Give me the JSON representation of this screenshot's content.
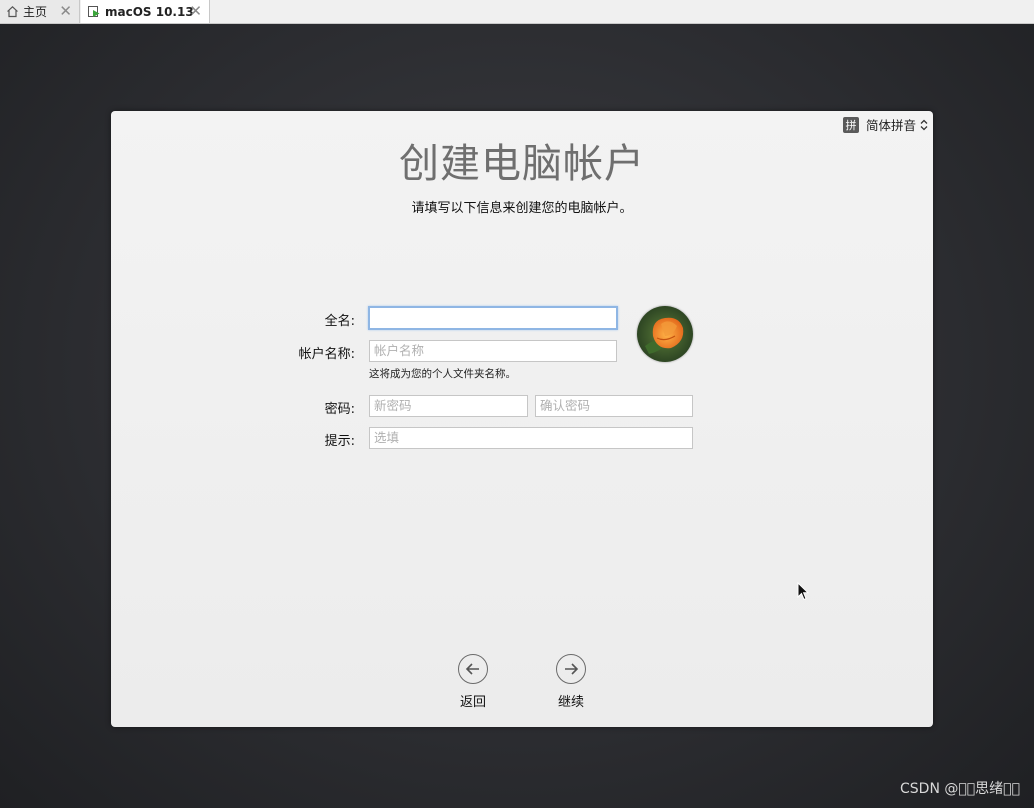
{
  "tabs": [
    {
      "label": "主页",
      "icon": "home-icon",
      "close": "✕"
    },
    {
      "label": "macOS 10.13",
      "icon": "vm-icon",
      "close": "✕"
    }
  ],
  "ime": {
    "badge": "拼",
    "label": "简体拼音"
  },
  "page": {
    "title": "创建电脑帐户",
    "subtitle": "请填写以下信息来创建您的电脑帐户。"
  },
  "form": {
    "fullname_label": "全名:",
    "fullname_value": "",
    "account_label": "帐户名称:",
    "account_placeholder": "帐户名称",
    "account_hint": "这将成为您的个人文件夹名称。",
    "password_label": "密码:",
    "password_placeholder": "新密码",
    "verify_placeholder": "确认密码",
    "hint_label": "提示:",
    "hint_placeholder": "选填"
  },
  "nav": {
    "back_label": "返回",
    "continue_label": "继续"
  },
  "watermark": "CSDN @\u0000\u0000思绪\u0000\u0000",
  "colors": {
    "background": "#2b2c30",
    "window": "#efefef",
    "focus": "#8fb6e4",
    "title": "#6f6f6f"
  }
}
